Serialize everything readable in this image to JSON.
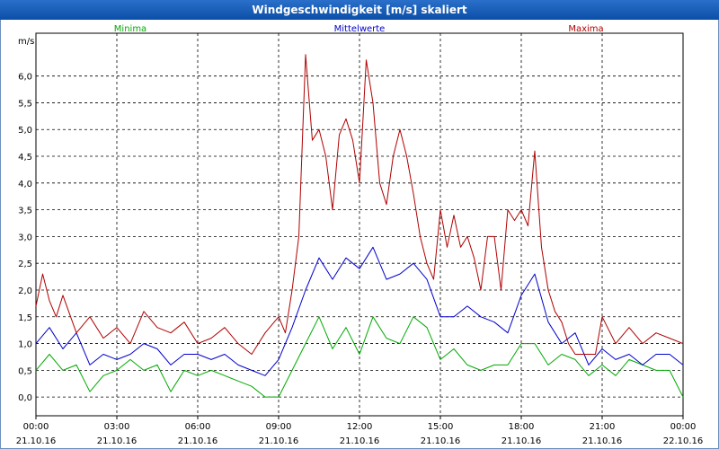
{
  "window": {
    "title": "Windgeschwindigkeit [m/s] skaliert"
  },
  "chart_data": {
    "type": "line",
    "title": "Windgeschwindigkeit [m/s] skaliert",
    "ylabel": "m/s",
    "ylim": [
      -0.35,
      6.8
    ],
    "yticks": [
      "0,0",
      "0,5",
      "1,0",
      "1,5",
      "2,0",
      "2,5",
      "3,0",
      "3,5",
      "4,0",
      "4,5",
      "5,0",
      "5,5",
      "6,0"
    ],
    "ytick_values": [
      0,
      0.5,
      1,
      1.5,
      2,
      2.5,
      3,
      3.5,
      4,
      4.5,
      5,
      5.5,
      6
    ],
    "xticks": [
      {
        "hour": 0,
        "time": "00:00",
        "date": "21.10.16"
      },
      {
        "hour": 3,
        "time": "03:00",
        "date": "21.10.16"
      },
      {
        "hour": 6,
        "time": "06:00",
        "date": "21.10.16"
      },
      {
        "hour": 9,
        "time": "09:00",
        "date": "21.10.16"
      },
      {
        "hour": 12,
        "time": "12:00",
        "date": "21.10.16"
      },
      {
        "hour": 15,
        "time": "15:00",
        "date": "21.10.16"
      },
      {
        "hour": 18,
        "time": "18:00",
        "date": "21.10.16"
      },
      {
        "hour": 21,
        "time": "21:00",
        "date": "21.10.16"
      },
      {
        "hour": 24,
        "time": "00:00",
        "date": "22.10.16"
      }
    ],
    "grid": true,
    "legend_position": "top",
    "series": [
      {
        "name": "Minima",
        "color": "#00aa00",
        "x": [
          0,
          0.5,
          1,
          1.5,
          2,
          2.5,
          3,
          3.5,
          4,
          4.5,
          5,
          5.5,
          6,
          6.5,
          7,
          7.5,
          8,
          8.5,
          9,
          9.5,
          10,
          10.5,
          11,
          11.5,
          12,
          12.5,
          13,
          13.5,
          14,
          14.5,
          15,
          15.5,
          16,
          16.5,
          17,
          17.5,
          18,
          18.5,
          19,
          19.5,
          20,
          20.5,
          21,
          21.5,
          22,
          22.5,
          23,
          23.5,
          24
        ],
        "values": [
          0.5,
          0.8,
          0.5,
          0.6,
          0.1,
          0.4,
          0.5,
          0.7,
          0.5,
          0.6,
          0.1,
          0.5,
          0.4,
          0.5,
          0.4,
          0.3,
          0.2,
          0.0,
          0.0,
          0.5,
          1.0,
          1.5,
          0.9,
          1.3,
          0.8,
          1.5,
          1.1,
          1.0,
          1.5,
          1.3,
          0.7,
          0.9,
          0.6,
          0.5,
          0.6,
          0.6,
          1.0,
          1.0,
          0.6,
          0.8,
          0.7,
          0.4,
          0.6,
          0.4,
          0.7,
          0.6,
          0.5,
          0.5,
          0.0
        ]
      },
      {
        "name": "Mittelwerte",
        "color": "#0000cc",
        "x": [
          0,
          0.5,
          1,
          1.5,
          2,
          2.5,
          3,
          3.5,
          4,
          4.5,
          5,
          5.5,
          6,
          6.5,
          7,
          7.5,
          8,
          8.5,
          9,
          9.5,
          10,
          10.5,
          11,
          11.5,
          12,
          12.5,
          13,
          13.5,
          14,
          14.5,
          15,
          15.5,
          16,
          16.5,
          17,
          17.5,
          18,
          18.5,
          19,
          19.5,
          20,
          20.5,
          21,
          21.5,
          22,
          22.5,
          23,
          23.5,
          24
        ],
        "values": [
          1.0,
          1.3,
          0.9,
          1.2,
          0.6,
          0.8,
          0.7,
          0.8,
          1.0,
          0.9,
          0.6,
          0.8,
          0.8,
          0.7,
          0.8,
          0.6,
          0.5,
          0.4,
          0.7,
          1.3,
          2.0,
          2.6,
          2.2,
          2.6,
          2.4,
          2.8,
          2.2,
          2.3,
          2.5,
          2.2,
          1.5,
          1.5,
          1.7,
          1.5,
          1.4,
          1.2,
          1.9,
          2.3,
          1.4,
          1.0,
          1.2,
          0.6,
          0.9,
          0.7,
          0.8,
          0.6,
          0.8,
          0.8,
          0.6
        ]
      },
      {
        "name": "Maxima",
        "color": "#b00000",
        "x": [
          0,
          0.25,
          0.5,
          0.75,
          1,
          1.5,
          2,
          2.5,
          3,
          3.5,
          4,
          4.5,
          5,
          5.5,
          6,
          6.5,
          7,
          7.5,
          8,
          8.5,
          9,
          9.25,
          9.5,
          9.75,
          10,
          10.25,
          10.5,
          10.75,
          11,
          11.25,
          11.5,
          11.75,
          12,
          12.25,
          12.5,
          12.75,
          13,
          13.25,
          13.5,
          13.75,
          14,
          14.25,
          14.5,
          14.75,
          15,
          15.25,
          15.5,
          15.75,
          16,
          16.25,
          16.5,
          16.75,
          17,
          17.25,
          17.5,
          17.75,
          18,
          18.25,
          18.5,
          18.75,
          19,
          19.25,
          19.5,
          19.75,
          20,
          20.25,
          20.5,
          20.75,
          21,
          21.5,
          22,
          22.5,
          23,
          23.5,
          24
        ],
        "values": [
          1.7,
          2.3,
          1.8,
          1.5,
          1.9,
          1.2,
          1.5,
          1.1,
          1.3,
          1.0,
          1.6,
          1.3,
          1.2,
          1.4,
          1.0,
          1.1,
          1.3,
          1.0,
          0.8,
          1.2,
          1.5,
          1.2,
          2.0,
          3.0,
          6.4,
          4.8,
          5.0,
          4.5,
          3.5,
          4.9,
          5.2,
          4.8,
          4.0,
          6.3,
          5.5,
          4.0,
          3.6,
          4.5,
          5.0,
          4.5,
          3.8,
          3.0,
          2.5,
          2.2,
          3.5,
          2.8,
          3.4,
          2.8,
          3.0,
          2.6,
          2.0,
          3.0,
          3.0,
          2.0,
          3.5,
          3.3,
          3.5,
          3.2,
          4.6,
          2.8,
          2.0,
          1.6,
          1.4,
          1.0,
          0.8,
          0.8,
          0.8,
          0.8,
          1.5,
          1.0,
          1.3,
          1.0,
          1.2,
          1.1,
          1.0
        ]
      }
    ]
  }
}
